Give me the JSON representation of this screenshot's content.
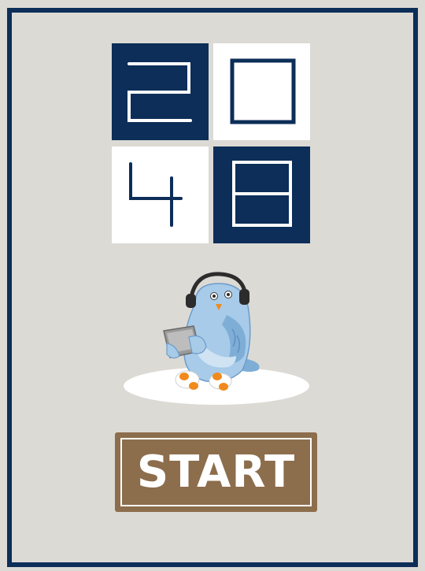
{
  "game": {
    "title_digits": [
      "2",
      "0",
      "4",
      "8"
    ],
    "start_label": "START"
  },
  "colors": {
    "background": "#dcdad5",
    "frame": "#0c2e58",
    "tile_dark": "#0c2e58",
    "tile_light": "#ffffff",
    "button": "#8c6d4c",
    "mascot_body": "#a7cbe8"
  },
  "mascot": {
    "icon": "bird-with-headphones-icon"
  }
}
